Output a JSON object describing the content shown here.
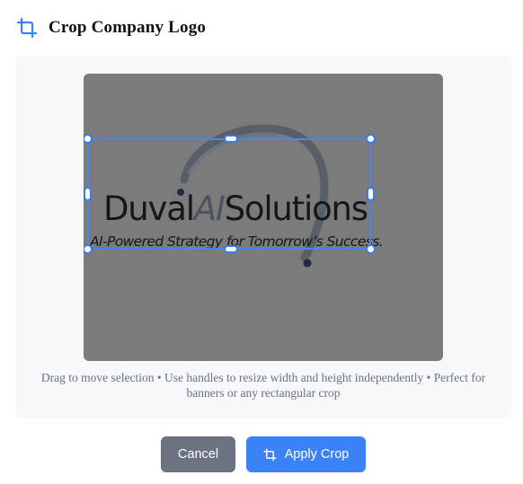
{
  "header": {
    "title": "Crop Company Logo",
    "icon": "crop-icon"
  },
  "logo": {
    "name_part1": "Duval",
    "name_ai": "AI",
    "name_part2": "Solutions",
    "tagline": "AI-Powered Strategy for Tomorrow’s Success."
  },
  "hint": "Drag to move selection • Use handles to resize width and height independently • Perfect for banners or any rectangular crop",
  "buttons": {
    "cancel": "Cancel",
    "apply": "Apply Crop",
    "apply_icon": "crop-icon"
  },
  "colors": {
    "accent": "#3b82f6",
    "cancel": "#6b7280",
    "canvas": "#7b7b7b",
    "crop_border": "#4a86e8"
  }
}
